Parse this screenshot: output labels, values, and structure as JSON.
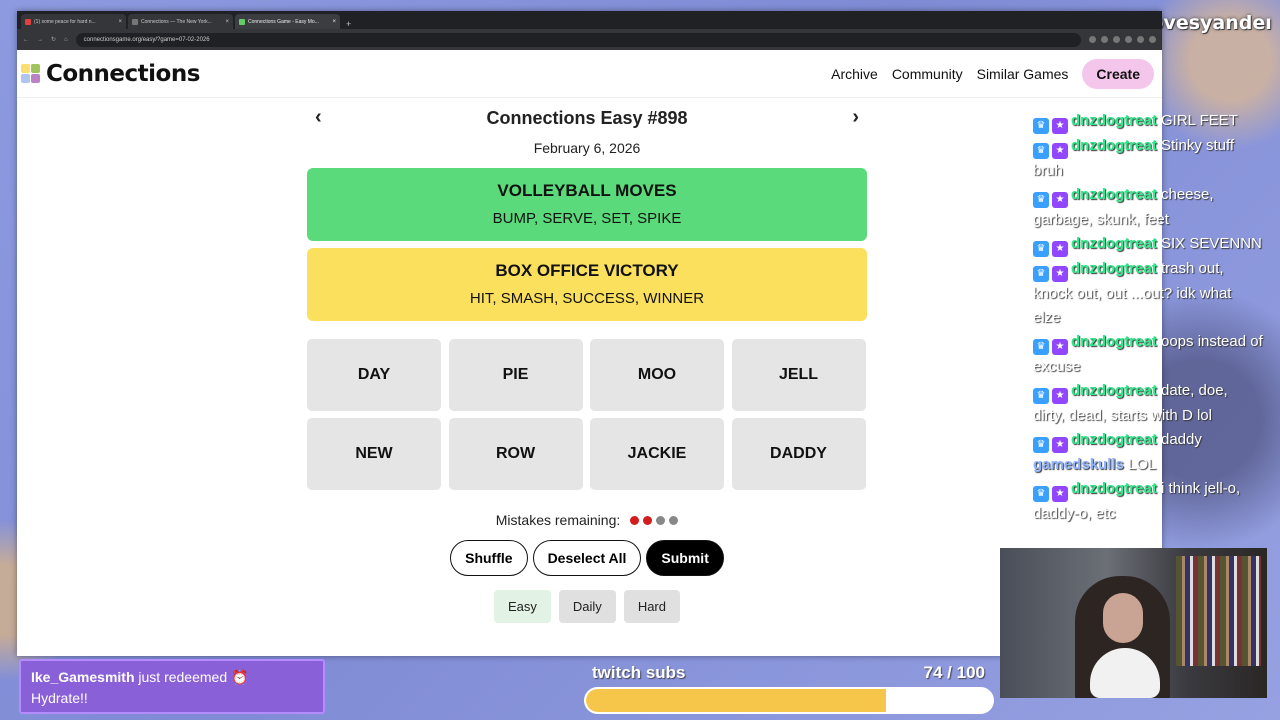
{
  "overlay": {
    "streamer_name": "shadowlovesyandeı",
    "redemption": {
      "user": "Ike_Gamesmith",
      "action": "just redeemed",
      "reward": "Hydrate!!"
    },
    "sub_goal": {
      "label": "twitch subs",
      "count": "74 / 100",
      "progress": 0.74
    }
  },
  "browser": {
    "tabs": [
      {
        "label": "(1) some peace for hard n..."
      },
      {
        "label": "Connections — The New York..."
      },
      {
        "label": "Connections Game - Easy Mo..."
      }
    ],
    "url": "connectionsgame.org/easy/?game=07-02-2026"
  },
  "site": {
    "logo_text": "Connections",
    "nav": {
      "archive": "Archive",
      "community": "Community",
      "similar": "Similar Games",
      "create": "Create"
    }
  },
  "game": {
    "title": "Connections Easy #898",
    "date": "February 6, 2026",
    "prev_icon": "‹",
    "next_icon": "›",
    "solved": [
      {
        "category": "VOLLEYBALL MOVES",
        "words": "BUMP, SERVE, SET, SPIKE",
        "color": "#5ada7a"
      },
      {
        "category": "BOX OFFICE VICTORY",
        "words": "HIT, SMASH, SUCCESS, WINNER",
        "color": "#fbe05e"
      }
    ],
    "tiles": [
      "DAY",
      "PIE",
      "MOO",
      "JELL",
      "NEW",
      "ROW",
      "JACKIE",
      "DADDY"
    ],
    "mistakes_label": "Mistakes remaining:",
    "mistakes_colors": [
      "#d31d1d",
      "#d31d1d",
      "#888888",
      "#888888"
    ],
    "buttons": {
      "shuffle": "Shuffle",
      "deselect": "Deselect All",
      "submit": "Submit"
    },
    "modes": {
      "easy": "Easy",
      "daily": "Daily",
      "hard": "Hard"
    }
  },
  "chat": [
    {
      "user": "dnzdogtreat",
      "text": "GIRL FEET"
    },
    {
      "user": "dnzdogtreat",
      "text": "Stinky stuff bruh"
    },
    {
      "user": "dnzdogtreat",
      "text": "cheese, garbage, skunk, feet"
    },
    {
      "user": "dnzdogtreat",
      "text": "SIX SEVENNN"
    },
    {
      "user": "dnzdogtreat",
      "text": "trash out, knock out, out ...out? idk what elze"
    },
    {
      "user": "dnzdogtreat",
      "text": "oops instead of excuse"
    },
    {
      "user": "dnzdogtreat",
      "text": "date, doe, dirty, dead, starts with D lol"
    },
    {
      "user": "dnzdogtreat",
      "text": "daddy"
    },
    {
      "user": "gamedskulls",
      "text": "LOL"
    },
    {
      "user": "dnzdogtreat",
      "text": "i think jell-o, daddy-o, etc"
    }
  ]
}
